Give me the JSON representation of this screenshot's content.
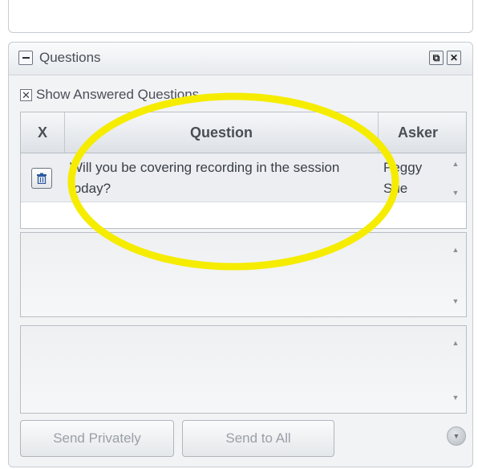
{
  "panel": {
    "title": "Questions",
    "buttons": {
      "popout_icon": "restore-window-icon",
      "close_icon": "close-icon"
    }
  },
  "show_answered": {
    "label": "Show Answered Questions",
    "checked": true
  },
  "table": {
    "columns": [
      "X",
      "Question",
      "Asker"
    ],
    "rows": [
      {
        "question": "Will you be covering recording in the session today?",
        "asker": "Peggy Sue"
      }
    ]
  },
  "buttons": {
    "send_privately": "Send Privately",
    "send_to_all": "Send to All"
  },
  "colors": {
    "highlight": "#f5ec00",
    "panel_bg": "#f2f3f5"
  }
}
